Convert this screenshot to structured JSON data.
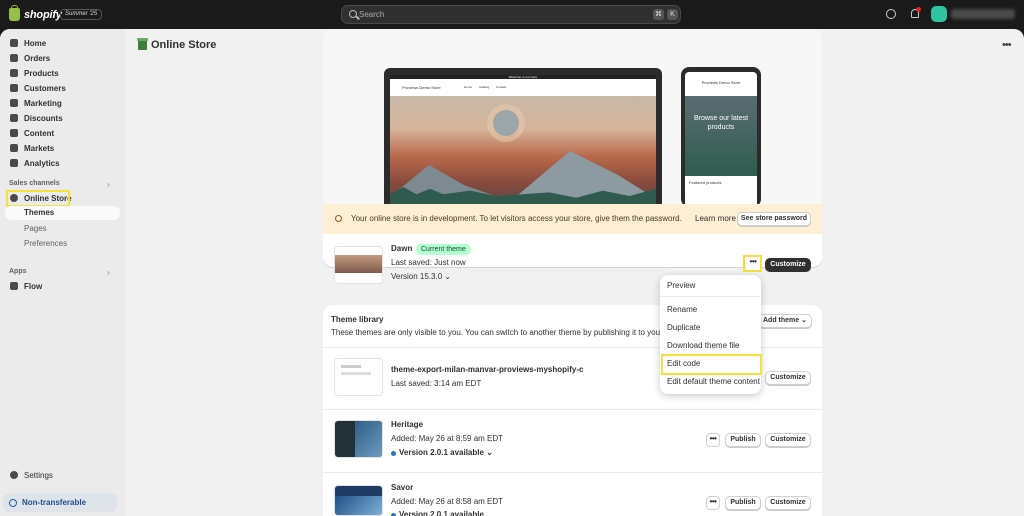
{
  "topbar": {
    "brand": "shopify",
    "edition": "Summer '25",
    "search_placeholder": "Search",
    "shortcut_keys": [
      "⌘",
      "K"
    ]
  },
  "page": {
    "title": "Online Store"
  },
  "sidebar": {
    "items": [
      "Home",
      "Orders",
      "Products",
      "Customers",
      "Marketing",
      "Discounts",
      "Content",
      "Markets",
      "Analytics"
    ],
    "sales_channels_title": "Sales channels",
    "online_store": "Online Store",
    "sub_items": [
      "Themes",
      "Pages",
      "Preferences"
    ],
    "apps_title": "Apps",
    "flow": "Flow",
    "settings": "Settings",
    "non_transferable": "Non-transferable"
  },
  "preview": {
    "store_name_laptop": "Proviews Demo Store",
    "laptop_nav": [
      "Home",
      "Catalog",
      "Contact"
    ],
    "announcement": "Welcome to our store",
    "store_name_phone": "Proviews Demo Store",
    "phone_banner": "Browse our latest products",
    "phone_featured": "Featured products"
  },
  "notice": {
    "text": "Your online store is in development. To let visitors access your store, give them the password.",
    "learn_more": "Learn more",
    "see_password": "See store password"
  },
  "current_theme": {
    "name": "Dawn",
    "badge": "Current theme",
    "last_saved": "Last saved: Just now",
    "version": "Version 15.3.0",
    "more": "•••",
    "customize": "Customize"
  },
  "menu": {
    "items": [
      "Preview",
      "Rename",
      "Duplicate",
      "Download theme file",
      "Edit code",
      "Edit default theme content"
    ]
  },
  "library": {
    "title": "Theme library",
    "subtitle": "These themes are only visible to you. You can switch to another theme by publishing it to your store.",
    "add_theme": "Add theme",
    "themes": [
      {
        "name": "theme-export-milan-manvar-proviews-myshopify-c",
        "meta": "Last saved: 3:14 am EDT",
        "customize": "Customize"
      },
      {
        "name": "Heritage",
        "meta": "Added: May 26 at 8:59 am EDT",
        "version": "Version 2.0.1 available",
        "publish": "Publish",
        "customize": "Customize",
        "more": "•••"
      },
      {
        "name": "Savor",
        "meta": "Added: May 26 at 8:58 am EDT",
        "version": "Version 2.0.1 available",
        "publish": "Publish",
        "customize": "Customize",
        "more": "•••"
      }
    ]
  },
  "colors": {
    "highlight": "#f4e13b",
    "badge_green": "#b4fed2",
    "notice_bg": "#fcefd4",
    "primary_dark": "#303030"
  }
}
